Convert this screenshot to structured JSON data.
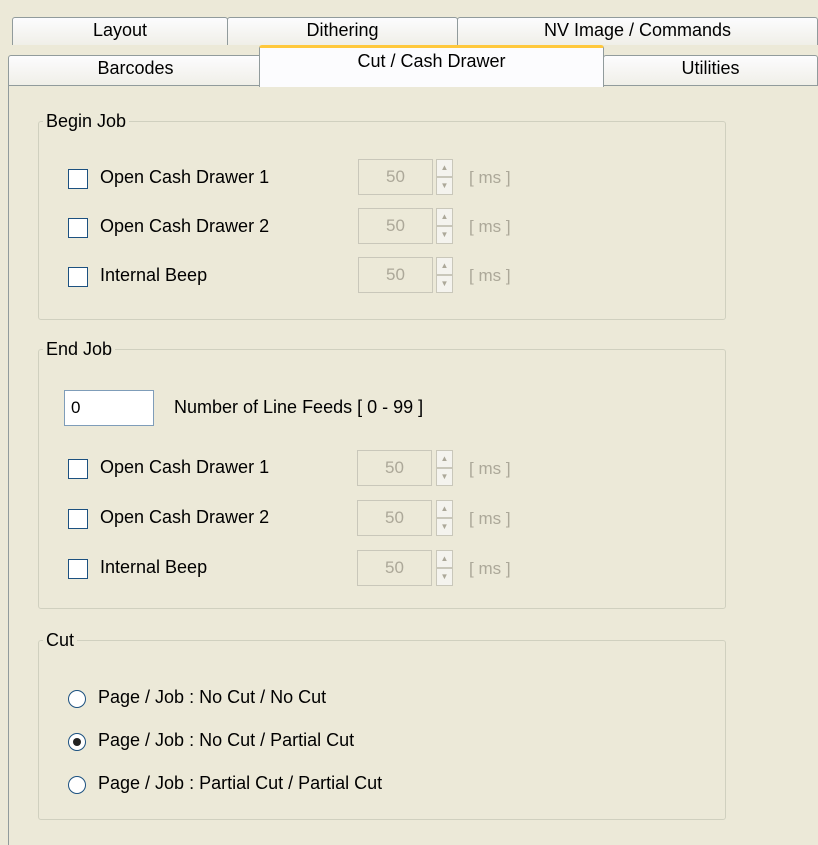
{
  "tabs": {
    "row1": [
      "Layout",
      "Dithering",
      "NV Image / Commands"
    ],
    "row2": [
      "Barcodes",
      "Cut / Cash Drawer",
      "Utilities"
    ],
    "active": "Cut / Cash Drawer"
  },
  "begin_job": {
    "title": "Begin Job",
    "items": [
      {
        "label": "Open Cash Drawer 1",
        "value": "50",
        "unit": "[ ms ]",
        "checked": false
      },
      {
        "label": "Open Cash Drawer 2",
        "value": "50",
        "unit": "[ ms ]",
        "checked": false
      },
      {
        "label": "Internal Beep",
        "value": "50",
        "unit": "[ ms ]",
        "checked": false
      }
    ]
  },
  "end_job": {
    "title": "End Job",
    "line_feeds_value": "0",
    "line_feeds_label": "Number of  Line Feeds [ 0 - 99 ]",
    "items": [
      {
        "label": "Open Cash Drawer 1",
        "value": "50",
        "unit": "[ ms ]",
        "checked": false
      },
      {
        "label": "Open Cash Drawer 2",
        "value": "50",
        "unit": "[ ms ]",
        "checked": false
      },
      {
        "label": "Internal Beep",
        "value": "50",
        "unit": "[ ms ]",
        "checked": false
      }
    ]
  },
  "cut": {
    "title": "Cut",
    "options": [
      {
        "label": "Page / Job : No Cut / No Cut",
        "selected": false
      },
      {
        "label": "Page / Job : No Cut / Partial Cut",
        "selected": true
      },
      {
        "label": "Page / Job : Partial Cut / Partial Cut",
        "selected": false
      }
    ]
  },
  "colors": {
    "window_bg": "#ece9d8",
    "active_tab_accent": "#ffc83c",
    "border": "#919b9c",
    "disabled_text": "#aca899"
  }
}
